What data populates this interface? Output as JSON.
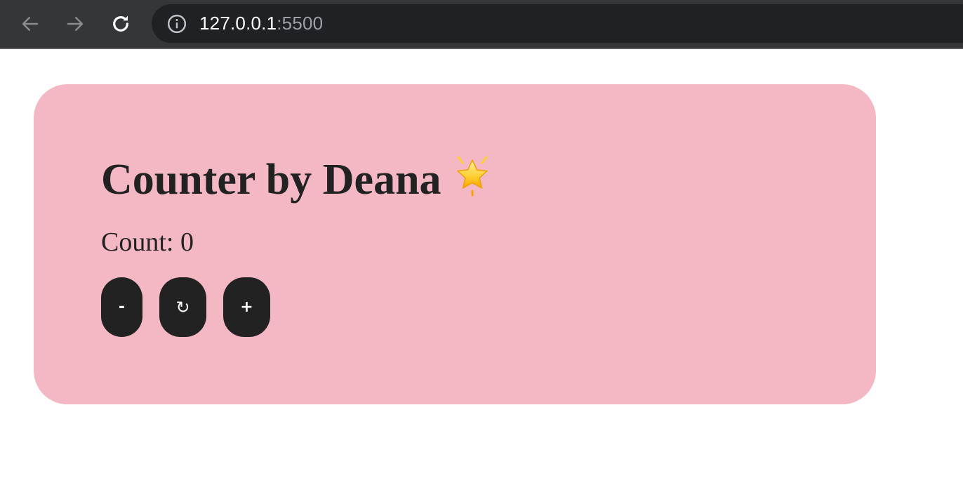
{
  "browser": {
    "url_host": "127.0.0.1",
    "url_port": ":5500",
    "icons": {
      "back": "arrow-left-icon",
      "forward": "arrow-right-icon",
      "reload": "reload-icon",
      "info": "info-icon"
    }
  },
  "app": {
    "title": "Counter by Deana",
    "title_emoji": "glowing-star-icon",
    "count_label": "Count:",
    "count_value": "0",
    "buttons": {
      "decrement": "-",
      "reset": "↻",
      "increment": "+"
    }
  },
  "colors": {
    "card_background": "#f4b8c4",
    "button_background": "#222222",
    "text": "#222222",
    "toolbar": "#35363a",
    "address_bar": "#202124"
  }
}
